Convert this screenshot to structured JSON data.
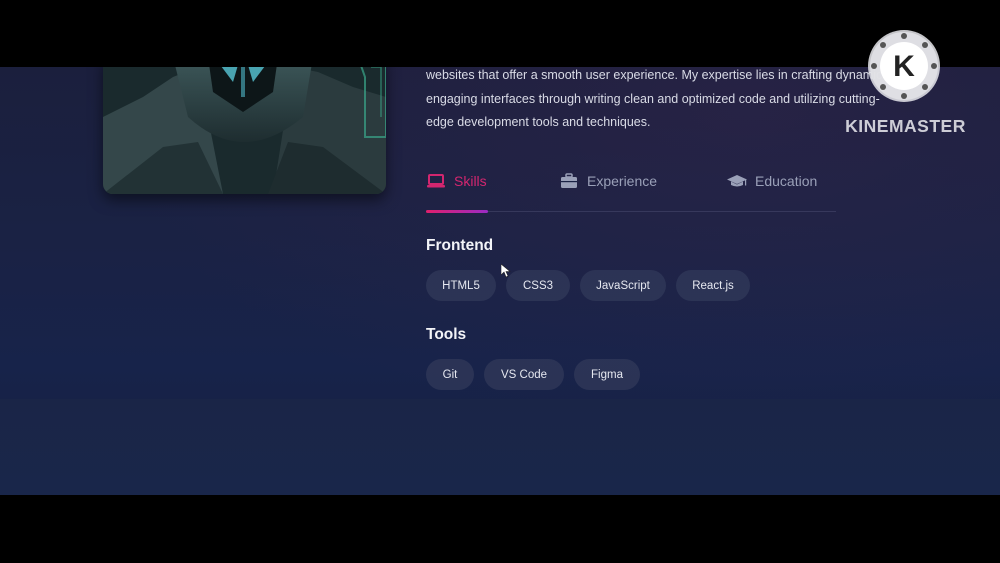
{
  "bio": {
    "lines": [
      "websites that offer a smooth user experience. My expertise lies in crafting dynamic,",
      "engaging interfaces through writing clean and optimized code and utilizing cutting-",
      "edge development tools and techniques."
    ]
  },
  "tabs": [
    {
      "label": "Skills",
      "icon": "laptop-icon",
      "active": true
    },
    {
      "label": "Experience",
      "icon": "briefcase-icon",
      "active": false
    },
    {
      "label": "Education",
      "icon": "graduation-cap-icon",
      "active": false
    }
  ],
  "skills": {
    "frontend": {
      "title": "Frontend",
      "items": [
        "HTML5",
        "CSS3",
        "JavaScript",
        "React.js"
      ]
    },
    "tools": {
      "title": "Tools",
      "items": [
        "Git",
        "VS Code",
        "Figma"
      ]
    }
  },
  "watermark": {
    "logo_letter": "K",
    "text": "KINEMASTER"
  },
  "colors": {
    "accent": "#d3266f",
    "accent_gradient_end": "#9b2bc4",
    "tab_inactive": "#9aa0b8",
    "background": "#1a2244"
  }
}
